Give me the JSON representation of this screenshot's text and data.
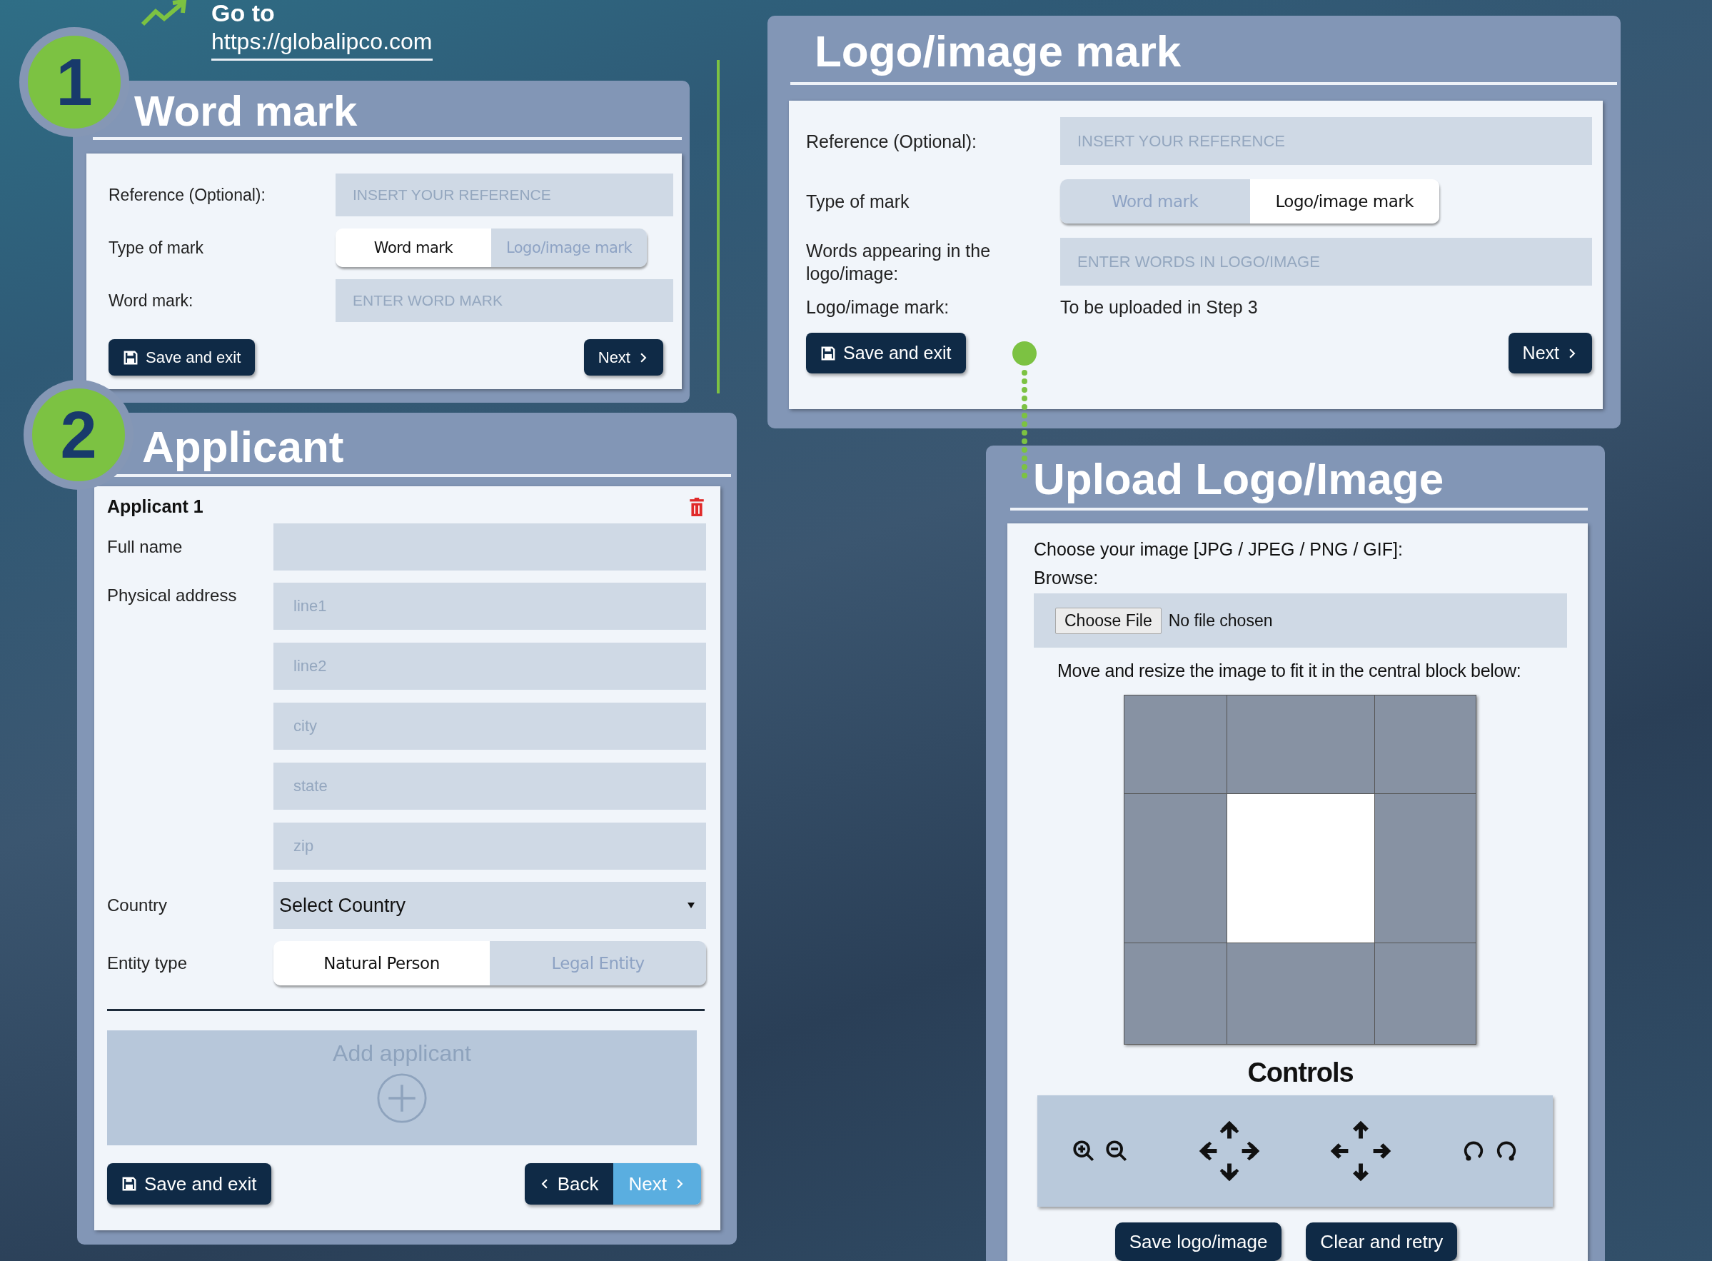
{
  "header": {
    "prefix": "Go to",
    "url": "https://globalipco.com"
  },
  "word_mark": {
    "step": "1",
    "title": "Word mark",
    "rows": [
      {
        "kind": "input",
        "label": "Reference (Optional):",
        "placeholder": "INSERT YOUR REFERENCE"
      },
      {
        "kind": "toggle",
        "label": "Type of mark",
        "options": [
          {
            "label": "Word mark",
            "selected": true
          },
          {
            "label": "Logo/image mark",
            "selected": false
          }
        ]
      },
      {
        "kind": "input",
        "label": "Word mark:",
        "placeholder": "ENTER WORD MARK"
      }
    ],
    "save_button": "Save and exit",
    "next_button": "Next"
  },
  "logo_mark": {
    "title": "Logo/image mark",
    "rows": [
      {
        "kind": "input",
        "label": "Reference (Optional):",
        "placeholder": "INSERT YOUR REFERENCE"
      },
      {
        "kind": "toggle",
        "label": "Type of mark",
        "options": [
          {
            "label": "Word mark",
            "selected": false
          },
          {
            "label": "Logo/image mark",
            "selected": true
          }
        ]
      },
      {
        "kind": "input",
        "label": "Words appearing in the logo/image:",
        "placeholder": "ENTER WORDS IN LOGO/IMAGE"
      },
      {
        "kind": "text",
        "label": "Logo/image mark:",
        "value": "To be uploaded in Step 3"
      }
    ],
    "save_button": "Save and exit",
    "next_button": "Next"
  },
  "applicant": {
    "step": "2",
    "title": "Applicant",
    "heading": "Applicant 1",
    "rows": [
      {
        "kind": "input",
        "label": "Full name"
      },
      {
        "kind": "address",
        "label": "Physical address",
        "placeholders": [
          "line1",
          "line2",
          "city",
          "state",
          "zip"
        ]
      },
      {
        "kind": "select",
        "label": "Country",
        "value": "Select Country"
      },
      {
        "kind": "toggle",
        "label": "Entity type",
        "options": [
          {
            "label": "Natural Person",
            "selected": true
          },
          {
            "label": "Legal Entity",
            "selected": false
          }
        ]
      }
    ],
    "add_applicant": "Add applicant",
    "save_button": "Save and exit",
    "back_button": "Back",
    "next_button": "Next"
  },
  "upload": {
    "title": "Upload Logo/Image",
    "prompt": "Choose your image [JPG / JPEG / PNG / GIF]:",
    "browse_label": "Browse:",
    "file_button": "Choose File",
    "file_status": "No file chosen",
    "instruction": "Move and resize the image to fit it in the central block below:",
    "controls_title": "Controls",
    "buttons": [
      "Save logo/image",
      "Clear and retry"
    ]
  }
}
